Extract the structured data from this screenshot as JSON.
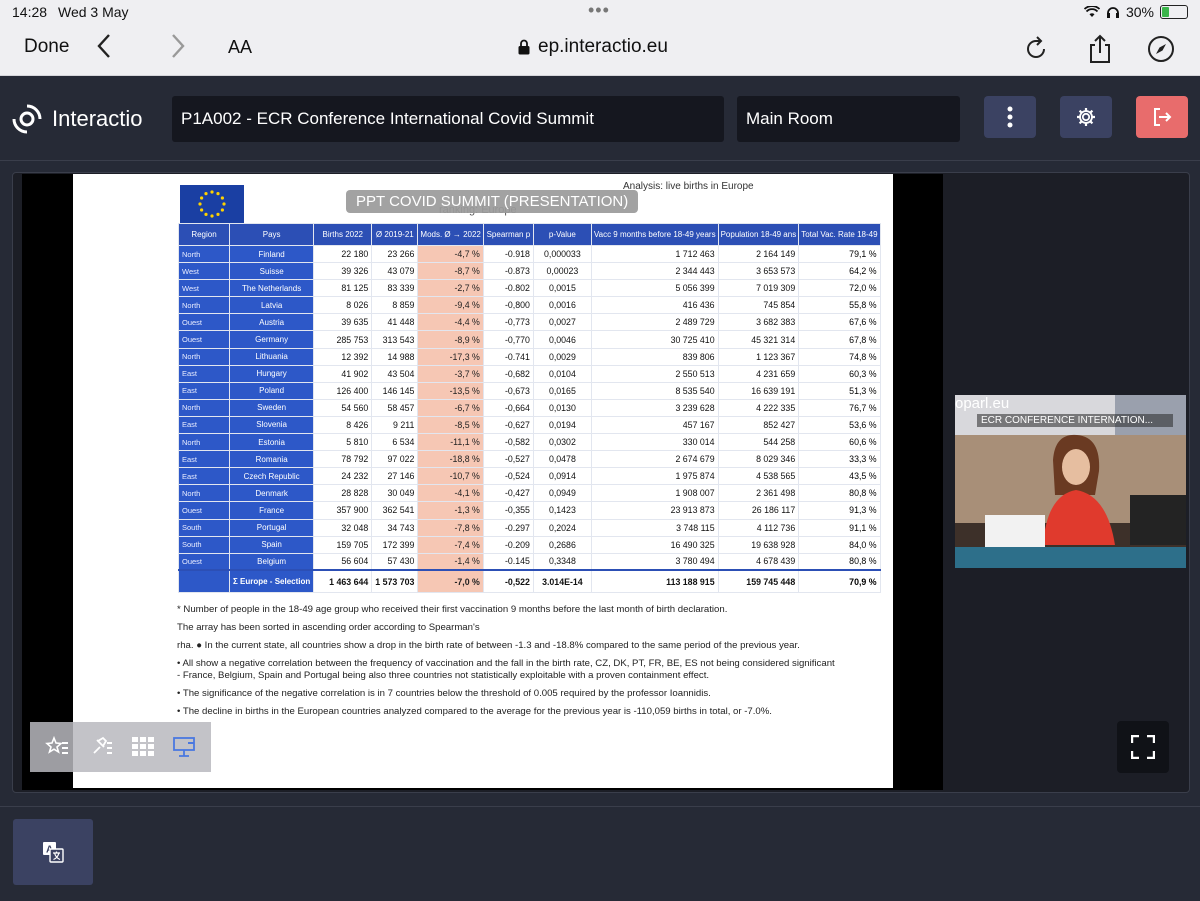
{
  "status_bar": {
    "time": "14:28",
    "date": "Wed 3 May",
    "battery": "30%",
    "battery_level": 0.3
  },
  "safari": {
    "done_label": "Done",
    "text_size_label": "AA",
    "url": "ep.interactio.eu"
  },
  "app": {
    "brand": "Interactio",
    "event_title": "P1A002 - ECR Conference International Covid Summit",
    "room": "Main Room",
    "overlay_label": "PPT COVID SUMMIT (PRESENTATION)",
    "pip_url_text": "oparl.eu",
    "pip_caption": "ECR CONFERENCE INTERNATION..."
  },
  "slide": {
    "analysis_label": "Analysis: live births in Europe",
    "subtitle": "ranking: Europe",
    "headers": [
      "Region",
      "Pays",
      "Births 2022",
      "Ø 2019-21",
      "Mods. Ø → 2022",
      "Spearman p",
      "p-Value",
      "Vacc 9 months before 18-49 years",
      "Population 18-49 ans",
      "Total Vac. Rate 18-49"
    ],
    "rows": [
      [
        "North",
        "Finland",
        "22 180",
        "23 266",
        "-4,7 %",
        "-0.918",
        "0,000033",
        "1 712 463",
        "2 164 149",
        "79,1 %"
      ],
      [
        "West",
        "Suisse",
        "39 326",
        "43 079",
        "-8,7 %",
        "-0.873",
        "0,00023",
        "2 344 443",
        "3 653 573",
        "64,2 %"
      ],
      [
        "West",
        "The Netherlands",
        "81 125",
        "83 339",
        "-2,7 %",
        "-0.802",
        "0,0015",
        "5 056 399",
        "7 019 309",
        "72,0 %"
      ],
      [
        "North",
        "Latvia",
        "8 026",
        "8 859",
        "-9,4 %",
        "-0,800",
        "0,0016",
        "416 436",
        "745 854",
        "55,8 %"
      ],
      [
        "Ouest",
        "Austria",
        "39 635",
        "41 448",
        "-4,4 %",
        "-0,773",
        "0,0027",
        "2 489 729",
        "3 682 383",
        "67,6 %"
      ],
      [
        "Ouest",
        "Germany",
        "285 753",
        "313 543",
        "-8,9 %",
        "-0,770",
        "0,0046",
        "30 725 410",
        "45 321 314",
        "67,8 %"
      ],
      [
        "North",
        "Lithuania",
        "12 392",
        "14 988",
        "-17,3 %",
        "-0.741",
        "0,0029",
        "839 806",
        "1 123 367",
        "74,8 %"
      ],
      [
        "East",
        "Hungary",
        "41 902",
        "43 504",
        "-3,7 %",
        "-0,682",
        "0,0104",
        "2 550 513",
        "4 231 659",
        "60,3 %"
      ],
      [
        "East",
        "Poland",
        "126 400",
        "146 145",
        "-13,5 %",
        "-0,673",
        "0,0165",
        "8 535 540",
        "16 639 191",
        "51,3 %"
      ],
      [
        "North",
        "Sweden",
        "54 560",
        "58 457",
        "-6,7 %",
        "-0,664",
        "0,0130",
        "3 239 628",
        "4 222 335",
        "76,7 %"
      ],
      [
        "East",
        "Slovenia",
        "8 426",
        "9 211",
        "-8,5 %",
        "-0,627",
        "0,0194",
        "457 167",
        "852 427",
        "53,6 %"
      ],
      [
        "North",
        "Estonia",
        "5 810",
        "6 534",
        "-11,1 %",
        "-0,582",
        "0,0302",
        "330 014",
        "544 258",
        "60,6 %"
      ],
      [
        "East",
        "Romania",
        "78 792",
        "97 022",
        "-18,8 %",
        "-0,527",
        "0,0478",
        "2 674 679",
        "8 029 346",
        "33,3 %"
      ],
      [
        "East",
        "Czech Republic",
        "24 232",
        "27 146",
        "-10,7 %",
        "-0,524",
        "0,0914",
        "1 975 874",
        "4 538 565",
        "43,5 %"
      ],
      [
        "North",
        "Denmark",
        "28 828",
        "30 049",
        "-4,1 %",
        "-0,427",
        "0,0949",
        "1 908 007",
        "2 361 498",
        "80,8 %"
      ],
      [
        "Ouest",
        "France",
        "357 900",
        "362 541",
        "-1,3 %",
        "-0,355",
        "0,1423",
        "23 913 873",
        "26 186 117",
        "91,3 %"
      ],
      [
        "South",
        "Portugal",
        "32 048",
        "34 743",
        "-7,8 %",
        "-0.297",
        "0,2024",
        "3 748 115",
        "4 112 736",
        "91,1 %"
      ],
      [
        "South",
        "Spain",
        "159 705",
        "172 399",
        "-7,4 %",
        "-0.209",
        "0,2686",
        "16 490 325",
        "19 638 928",
        "84,0 %"
      ],
      [
        "Ouest",
        "Belgium",
        "56 604",
        "57 430",
        "-1,4 %",
        "-0.145",
        "0,3348",
        "3 780 494",
        "4 678 439",
        "80,8 %"
      ]
    ],
    "total_row": [
      "",
      "Σ Europe - Selection",
      "1 463 644",
      "1 573 703",
      "-7,0 %",
      "-0,522",
      "3.014E-14",
      "113 188 915",
      "159 745 448",
      "70,9 %"
    ],
    "notes": [
      "* Number of people in the 18-49 age group who received their first vaccination 9 months before the last month of birth declaration.",
      "The array has been sorted in ascending order according to Spearman's",
      "rha. ● In the current state, all countries show a drop in the birth rate of between -1.3 and -18.8% compared to the same period of the previous year.",
      "• All show a negative correlation between the frequency of vaccination and the fall in the birth rate, CZ, DK, PT, FR, BE, ES not being considered significant - France, Belgium, Spain and Portugal being also three countries not statistically exploitable with a proven containment effect.",
      "• The significance of the negative correlation is in 7 countries below the threshold of 0.005 required by the professor Ioannidis.",
      "• The decline in births in the European countries analyzed compared to the average for the previous year is -110,059 births in total, or -7.0%."
    ]
  }
}
